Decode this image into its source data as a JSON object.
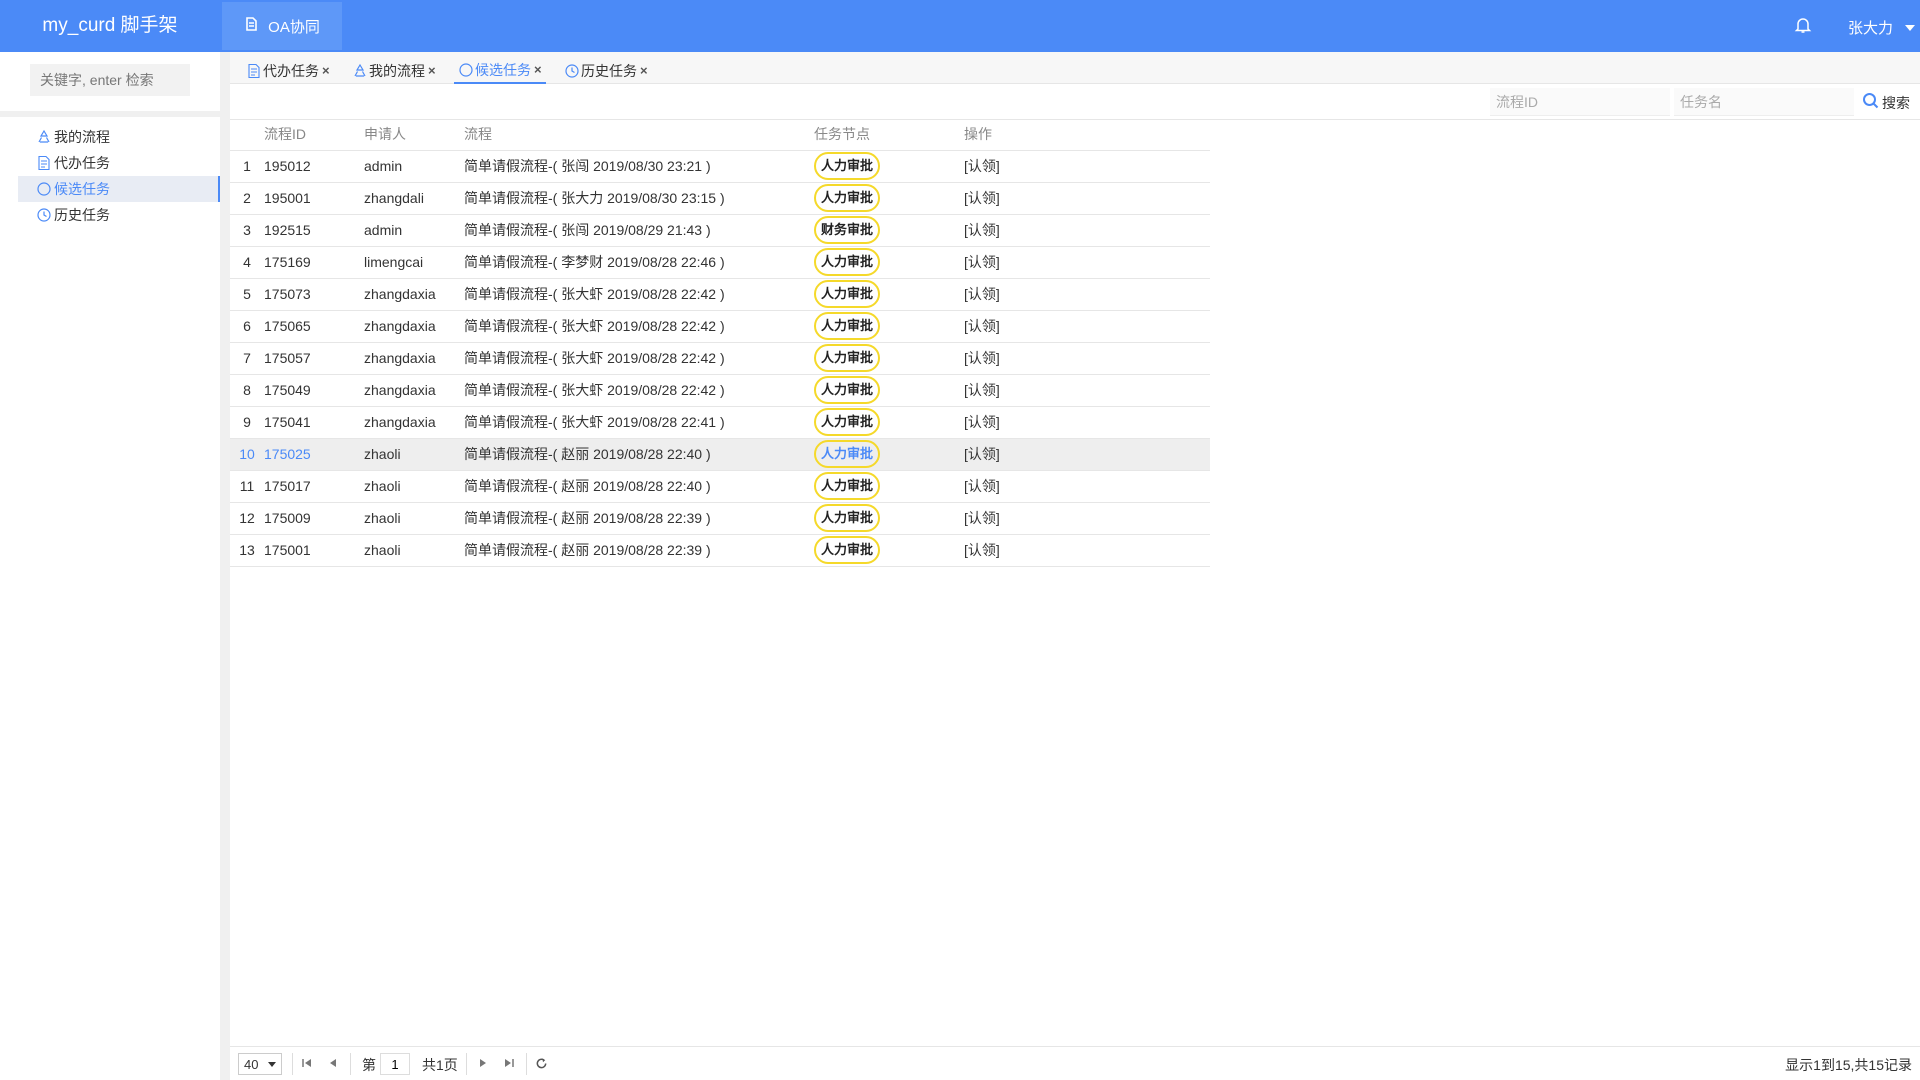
{
  "app": {
    "brand": "my_curd 脚手架",
    "module_tab": "OA协同",
    "user": "张大力"
  },
  "sidebar": {
    "search_placeholder": "关键字, enter 检索",
    "items": [
      {
        "label": "我的流程",
        "icon": "recycle-icon"
      },
      {
        "label": "代办任务",
        "icon": "doc-icon"
      },
      {
        "label": "候选任务",
        "icon": "circle-icon",
        "active": true
      },
      {
        "label": "历史任务",
        "icon": "clock-icon"
      }
    ]
  },
  "tabs": [
    {
      "label": "代办任务",
      "close": "×"
    },
    {
      "label": "我的流程",
      "close": "×"
    },
    {
      "label": "候选任务",
      "close": "×"
    },
    {
      "label": "历史任务",
      "close": "×"
    }
  ],
  "filters": {
    "process_id_placeholder": "流程ID",
    "task_name_placeholder": "任务名",
    "search_label": "搜索"
  },
  "table": {
    "headers": [
      "流程ID",
      "申请人",
      "流程",
      "任务节点",
      "操作"
    ],
    "rows": [
      {
        "n": "1",
        "id": "195012",
        "applicant": "admin",
        "flow": "简单请假流程-( 张闯 2019/08/30 23:21 )",
        "node": "人力审批",
        "op": "[认领]"
      },
      {
        "n": "2",
        "id": "195001",
        "applicant": "zhangdali",
        "flow": "简单请假流程-( 张大力 2019/08/30 23:15 )",
        "node": "人力审批",
        "op": "[认领]"
      },
      {
        "n": "3",
        "id": "192515",
        "applicant": "admin",
        "flow": "简单请假流程-( 张闯 2019/08/29 21:43 )",
        "node": "财务审批",
        "op": "[认领]"
      },
      {
        "n": "4",
        "id": "175169",
        "applicant": "limengcai",
        "flow": "简单请假流程-( 李梦财 2019/08/28 22:46 )",
        "node": "人力审批",
        "op": "[认领]"
      },
      {
        "n": "5",
        "id": "175073",
        "applicant": "zhangdaxia",
        "flow": "简单请假流程-( 张大虾 2019/08/28 22:42 )",
        "node": "人力审批",
        "op": "[认领]"
      },
      {
        "n": "6",
        "id": "175065",
        "applicant": "zhangdaxia",
        "flow": "简单请假流程-( 张大虾 2019/08/28 22:42 )",
        "node": "人力审批",
        "op": "[认领]"
      },
      {
        "n": "7",
        "id": "175057",
        "applicant": "zhangdaxia",
        "flow": "简单请假流程-( 张大虾 2019/08/28 22:42 )",
        "node": "人力审批",
        "op": "[认领]"
      },
      {
        "n": "8",
        "id": "175049",
        "applicant": "zhangdaxia",
        "flow": "简单请假流程-( 张大虾 2019/08/28 22:42 )",
        "node": "人力审批",
        "op": "[认领]"
      },
      {
        "n": "9",
        "id": "175041",
        "applicant": "zhangdaxia",
        "flow": "简单请假流程-( 张大虾 2019/08/28 22:41 )",
        "node": "人力审批",
        "op": "[认领]"
      },
      {
        "n": "10",
        "id": "175025",
        "applicant": "zhaoli",
        "flow": "简单请假流程-( 赵丽 2019/08/28 22:40 )",
        "node": "人力审批",
        "op": "[认领]",
        "highlight": true
      },
      {
        "n": "11",
        "id": "175017",
        "applicant": "zhaoli",
        "flow": "简单请假流程-( 赵丽 2019/08/28 22:40 )",
        "node": "人力审批",
        "op": "[认领]"
      },
      {
        "n": "12",
        "id": "175009",
        "applicant": "zhaoli",
        "flow": "简单请假流程-( 赵丽 2019/08/28 22:39 )",
        "node": "人力审批",
        "op": "[认领]"
      },
      {
        "n": "13",
        "id": "175001",
        "applicant": "zhaoli",
        "flow": "简单请假流程-( 赵丽 2019/08/28 22:39 )",
        "node": "人力审批",
        "op": "[认领]"
      }
    ]
  },
  "pager": {
    "page_size": "40",
    "page_prefix": "第",
    "page": "1",
    "page_total": "共1页",
    "info": "显示1到15,共15记录"
  },
  "colors": {
    "primary": "#4b8af7",
    "badge_border": "#f5d92a"
  }
}
